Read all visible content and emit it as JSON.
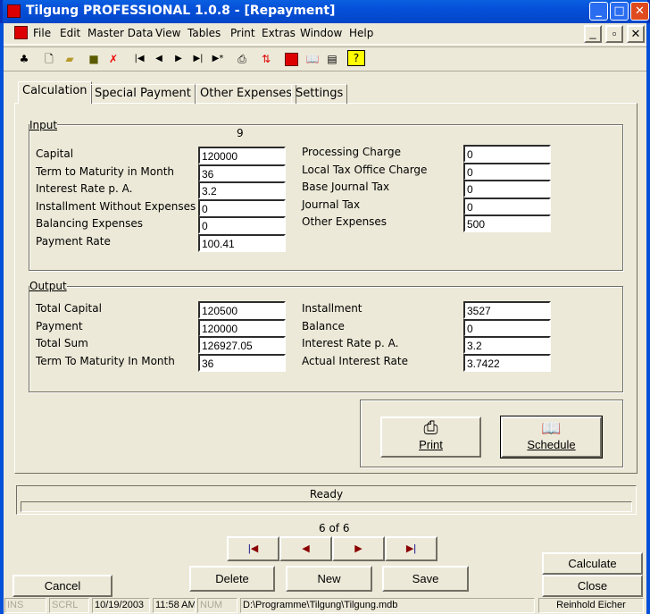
{
  "window": {
    "title": "Tilgung PROFESSIONAL 1.0.8 - [Repayment]"
  },
  "menu": [
    "File",
    "Edit",
    "Master Data",
    "View",
    "Tables",
    "Print",
    "Extras",
    "Window",
    "Help"
  ],
  "tabs": [
    "Calculation",
    "Special Payment",
    "Other Expenses",
    "Settings"
  ],
  "input": {
    "label": "Input",
    "record_no": "9",
    "left": [
      {
        "label": "Capital",
        "value": "120000"
      },
      {
        "label": "Term to Maturity in Month",
        "value": "36"
      },
      {
        "label": "Interest Rate p. A.",
        "value": "3.2"
      },
      {
        "label": "Installment Without Expenses",
        "value": "0"
      },
      {
        "label": "Balancing Expenses",
        "value": "0"
      },
      {
        "label": "Payment Rate",
        "value": "100.41"
      }
    ],
    "right": [
      {
        "label": "Processing Charge",
        "value": "0"
      },
      {
        "label": "Local Tax Office Charge",
        "value": "0"
      },
      {
        "label": "Base Journal Tax",
        "value": "0"
      },
      {
        "label": "Journal Tax",
        "value": "0"
      },
      {
        "label": "Other Expenses",
        "value": "500"
      }
    ]
  },
  "output": {
    "label": "Output",
    "left": [
      {
        "label": "Total Capital",
        "value": "120500"
      },
      {
        "label": "Payment",
        "value": "120000"
      },
      {
        "label": "Total Sum",
        "value": "126927.05"
      },
      {
        "label": "Term To Maturity In Month",
        "value": "36"
      }
    ],
    "right": [
      {
        "label": "Installment",
        "value": "3527"
      },
      {
        "label": "Balance",
        "value": "0"
      },
      {
        "label": "Interest Rate p. A.",
        "value": "3.2"
      },
      {
        "label": "Actual Interest Rate",
        "value": "3.7422"
      }
    ]
  },
  "actions": {
    "print": "Print",
    "schedule": "Schedule"
  },
  "status": {
    "text": "Ready"
  },
  "nav": {
    "position": "6 of 6"
  },
  "buttons": {
    "delete": "Delete",
    "new": "New",
    "save": "Save",
    "cancel": "Cancel",
    "calculate": "Calculate",
    "close": "Close"
  },
  "statusbar": [
    "INS",
    "SCRL",
    "10/19/2003",
    "11:58 AM",
    "NUM",
    "D:\\Programme\\Tilgung\\Tilgung.mdb",
    "Reinhold Eicher"
  ]
}
